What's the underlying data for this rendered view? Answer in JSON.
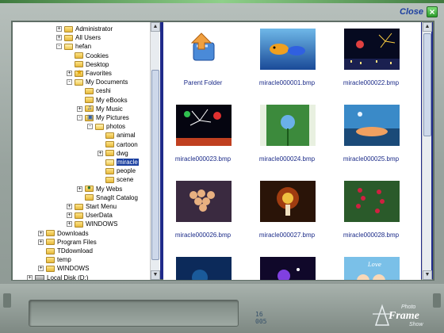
{
  "window": {
    "close_label": "Close",
    "close_icon": "x-icon"
  },
  "tree": {
    "items": [
      {
        "label": "Administrator",
        "depth": 1,
        "exp": "+",
        "icon": "folder"
      },
      {
        "label": "All Users",
        "depth": 1,
        "exp": "+",
        "icon": "folder"
      },
      {
        "label": "hefan",
        "depth": 1,
        "exp": "-",
        "icon": "folder-open"
      },
      {
        "label": "Cookies",
        "depth": 2,
        "exp": "",
        "icon": "folder"
      },
      {
        "label": "Desktop",
        "depth": 2,
        "exp": "",
        "icon": "folder"
      },
      {
        "label": "Favorites",
        "depth": 2,
        "exp": "+",
        "icon": "star"
      },
      {
        "label": "My Documents",
        "depth": 2,
        "exp": "-",
        "icon": "folder-open"
      },
      {
        "label": "ceshi",
        "depth": 3,
        "exp": "",
        "icon": "folder"
      },
      {
        "label": "My eBooks",
        "depth": 3,
        "exp": "",
        "icon": "folder"
      },
      {
        "label": "My Music",
        "depth": 3,
        "exp": "+",
        "icon": "music"
      },
      {
        "label": "My Pictures",
        "depth": 3,
        "exp": "-",
        "icon": "pics"
      },
      {
        "label": "photos",
        "depth": 4,
        "exp": "-",
        "icon": "folder-open"
      },
      {
        "label": "animal",
        "depth": 5,
        "exp": "",
        "icon": "folder"
      },
      {
        "label": "cartoon",
        "depth": 5,
        "exp": "",
        "icon": "folder"
      },
      {
        "label": "dwg",
        "depth": 5,
        "exp": "+",
        "icon": "folder"
      },
      {
        "label": "miracle",
        "depth": 5,
        "exp": "",
        "icon": "folder-open",
        "selected": true
      },
      {
        "label": "people",
        "depth": 5,
        "exp": "",
        "icon": "folder"
      },
      {
        "label": "scene",
        "depth": 5,
        "exp": "",
        "icon": "folder"
      },
      {
        "label": "My Webs",
        "depth": 3,
        "exp": "+",
        "icon": "web"
      },
      {
        "label": "SnagIt Catalog",
        "depth": 3,
        "exp": "",
        "icon": "folder"
      },
      {
        "label": "Start Menu",
        "depth": 2,
        "exp": "+",
        "icon": "folder"
      },
      {
        "label": "UserData",
        "depth": 2,
        "exp": "+",
        "icon": "folder"
      },
      {
        "label": "WINDOWS",
        "depth": 2,
        "exp": "+",
        "icon": "folder"
      },
      {
        "label": "Downloads",
        "depth": 0,
        "exp": "+",
        "icon": "folder"
      },
      {
        "label": "Program Files",
        "depth": 0,
        "exp": "+",
        "icon": "folder"
      },
      {
        "label": "TDdownload",
        "depth": 0,
        "exp": "",
        "icon": "folder"
      },
      {
        "label": "temp",
        "depth": 0,
        "exp": "",
        "icon": "folder"
      },
      {
        "label": "WINDOWS",
        "depth": 0,
        "exp": "+",
        "icon": "folder"
      },
      {
        "label": "Local Disk (D:)",
        "depth": -1,
        "exp": "+",
        "icon": "drive"
      }
    ]
  },
  "thumbnails": [
    {
      "label": "Parent Folder",
      "kind": "parent"
    },
    {
      "label": "miracle000001.bmp",
      "kind": "fish"
    },
    {
      "label": "miracle000022.bmp",
      "kind": "fireworks-city"
    },
    {
      "label": "miracle000023.bmp",
      "kind": "fireworks"
    },
    {
      "label": "miracle000024.bmp",
      "kind": "flower-green"
    },
    {
      "label": "miracle000025.bmp",
      "kind": "underwater"
    },
    {
      "label": "miracle000026.bmp",
      "kind": "grapes"
    },
    {
      "label": "miracle000027.bmp",
      "kind": "candle"
    },
    {
      "label": "miracle000028.bmp",
      "kind": "red-flowers"
    },
    {
      "label": "",
      "kind": "dark-blue"
    },
    {
      "label": "",
      "kind": "purple-flowers"
    },
    {
      "label": "",
      "kind": "cartoon-kids"
    }
  ],
  "status": {
    "counter_line1": "16",
    "counter_line2": "005"
  },
  "logo": {
    "line1": "Photo",
    "line2": "Frame",
    "line3": "Show"
  },
  "colors": {
    "window_bg": "#1f2a8a",
    "selection": "#1a3fa0",
    "label_blue": "#1a2a88",
    "accent_green": "#2a9a2a"
  }
}
